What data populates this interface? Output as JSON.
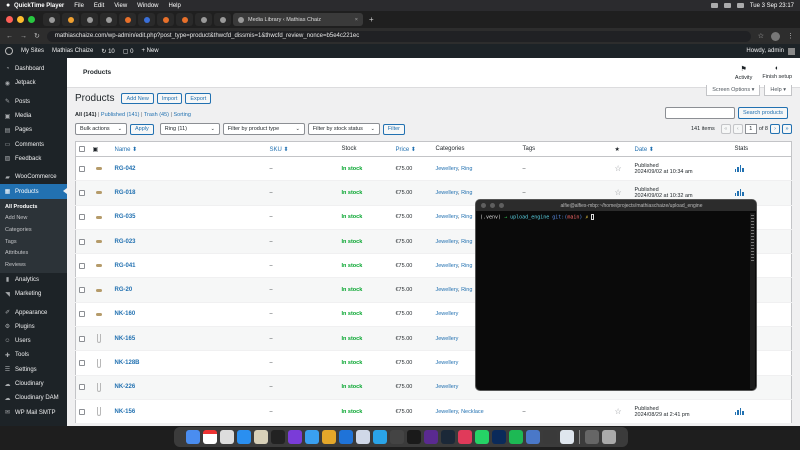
{
  "menubar": {
    "items": [
      "QuickTime Player",
      "File",
      "Edit",
      "View",
      "Window",
      "Help"
    ],
    "clock": "Tue 3 Sep 23:17"
  },
  "browser": {
    "tab_title": "Media Library ‹ Mathias Chaiz",
    "url": "mathiaschaize.com/wp-admin/edit.php?post_type=product&thwcfd_dissmis=1&thwcfd_review_nonce=b5e4c221ec"
  },
  "adminbar": {
    "my_sites": "My Sites",
    "site_name": "Mathias Chaize",
    "updates": "10",
    "comments": "0",
    "new": "New",
    "howdy": "Howdy, admin"
  },
  "sidebar": {
    "items": [
      {
        "label": "Dashboard",
        "icon": "dashboard-icon"
      },
      {
        "label": "Jetpack",
        "icon": "jetpack-icon"
      },
      {
        "label": "Posts",
        "icon": "pin-icon"
      },
      {
        "label": "Media",
        "icon": "media-icon"
      },
      {
        "label": "Pages",
        "icon": "pages-icon"
      },
      {
        "label": "Comments",
        "icon": "comments-icon"
      },
      {
        "label": "Feedback",
        "icon": "feedback-icon"
      },
      {
        "label": "WooCommerce",
        "icon": "woo-icon"
      },
      {
        "label": "Products",
        "icon": "products-icon"
      }
    ],
    "sub": [
      "All Products",
      "Add New",
      "Categories",
      "Tags",
      "Attributes",
      "Reviews"
    ],
    "lower": [
      {
        "label": "Analytics",
        "icon": "analytics-icon"
      },
      {
        "label": "Marketing",
        "icon": "marketing-icon"
      },
      {
        "label": "Appearance",
        "icon": "appearance-icon"
      },
      {
        "label": "Plugins",
        "icon": "plugins-icon"
      },
      {
        "label": "Users",
        "icon": "users-icon"
      },
      {
        "label": "Tools",
        "icon": "tools-icon"
      },
      {
        "label": "Settings",
        "icon": "settings-icon"
      },
      {
        "label": "Cloudinary",
        "icon": "cloud-icon"
      },
      {
        "label": "Cloudinary DAM",
        "icon": "cloud-icon"
      },
      {
        "label": "WP Mail SMTP",
        "icon": "mail-icon"
      }
    ]
  },
  "header": {
    "title": "Products",
    "activity": "Activity",
    "finish_setup": "Finish setup",
    "screen_options": "Screen Options ▾",
    "help": "Help ▾"
  },
  "page": {
    "heading": "Products",
    "add_new": "Add New",
    "import": "Import",
    "export": "Export",
    "filter_all": "All (141)",
    "filter_published": "Published (141)",
    "filter_trash": "Trash (45)",
    "filter_sorting": "Sorting",
    "search_button": "Search products",
    "bulk_actions": "Bulk actions",
    "apply": "Apply",
    "category_select": "Ring  (11)",
    "product_type_select": "Filter by product type",
    "stock_status_select": "Filter by stock status",
    "filter": "Filter",
    "items_count": "141 items",
    "current_page": "1",
    "total_pages": "of 8"
  },
  "table": {
    "columns": {
      "name": "Name ⬍",
      "sku": "SKU ⬍",
      "stock": "Stock",
      "price": "Price ⬍",
      "categories": "Categories",
      "tags": "Tags",
      "date": "Date ⬍",
      "stats": "Stats"
    },
    "rows": [
      {
        "name": "RG-042",
        "sku": "–",
        "stock": "In stock",
        "price": "€75.00",
        "cat1": "Jewellery",
        "cat2": "Ring",
        "tags": "–",
        "date1": "Published",
        "date2": "2024/09/02 at 10:34 am",
        "thumb": "ring"
      },
      {
        "name": "RG-018",
        "sku": "–",
        "stock": "In stock",
        "price": "€75.00",
        "cat1": "Jewellery",
        "cat2": "Ring",
        "tags": "–",
        "date1": "Published",
        "date2": "2024/09/02 at 10:32 am",
        "thumb": "ring"
      },
      {
        "name": "RG-035",
        "sku": "–",
        "stock": "In stock",
        "price": "€75.00",
        "cat1": "Jewellery",
        "cat2": "Ring",
        "tags": "",
        "date1": "",
        "date2": "",
        "thumb": "ring"
      },
      {
        "name": "RG-023",
        "sku": "–",
        "stock": "In stock",
        "price": "€75.00",
        "cat1": "Jewellery",
        "cat2": "Ring",
        "tags": "",
        "date1": "",
        "date2": "",
        "thumb": "ring"
      },
      {
        "name": "RG-041",
        "sku": "–",
        "stock": "In stock",
        "price": "€75.00",
        "cat1": "Jewellery",
        "cat2": "Ring",
        "tags": "",
        "date1": "",
        "date2": "",
        "thumb": "ring"
      },
      {
        "name": "RG-20",
        "sku": "–",
        "stock": "In stock",
        "price": "€75.00",
        "cat1": "Jewellery",
        "cat2": "Ring",
        "tags": "",
        "date1": "",
        "date2": "",
        "thumb": "ring"
      },
      {
        "name": "NK-160",
        "sku": "–",
        "stock": "In stock",
        "price": "€75.00",
        "cat1": "Jewellery",
        "cat2": "",
        "tags": "",
        "date1": "",
        "date2": "",
        "thumb": "ring"
      },
      {
        "name": "NK-165",
        "sku": "–",
        "stock": "In stock",
        "price": "€75.00",
        "cat1": "Jewellery",
        "cat2": "",
        "tags": "",
        "date1": "",
        "date2": "",
        "thumb": "neck"
      },
      {
        "name": "NK-128B",
        "sku": "–",
        "stock": "In stock",
        "price": "€75.00",
        "cat1": "Jewellery",
        "cat2": "",
        "tags": "",
        "date1": "",
        "date2": "",
        "thumb": "neck"
      },
      {
        "name": "NK-226",
        "sku": "–",
        "stock": "In stock",
        "price": "€75.00",
        "cat1": "Jewellery",
        "cat2": "",
        "tags": "",
        "date1": "",
        "date2": "",
        "thumb": "neck"
      },
      {
        "name": "NK-156",
        "sku": "–",
        "stock": "In stock",
        "price": "€75.00",
        "cat1": "Jewellery",
        "cat2": "Necklace",
        "tags": "–",
        "date1": "Published",
        "date2": "2024/08/29 at 2:41 pm",
        "thumb": "neck"
      }
    ]
  },
  "terminal": {
    "title": "alfie@alfies-mbp:~/home/projects/mathiaschaize/upload_engine",
    "prompt_venv": "(.venv)",
    "prompt_arrow": "→",
    "prompt_dir": "upload_engine",
    "prompt_git": "git:(",
    "prompt_branch": "main",
    "prompt_git_end": ")",
    "prompt_mark": "✗"
  },
  "colors": {
    "wp_blue": "#2271b1",
    "admin_dark": "#1d2327",
    "in_stock_green": "#00a32a"
  }
}
